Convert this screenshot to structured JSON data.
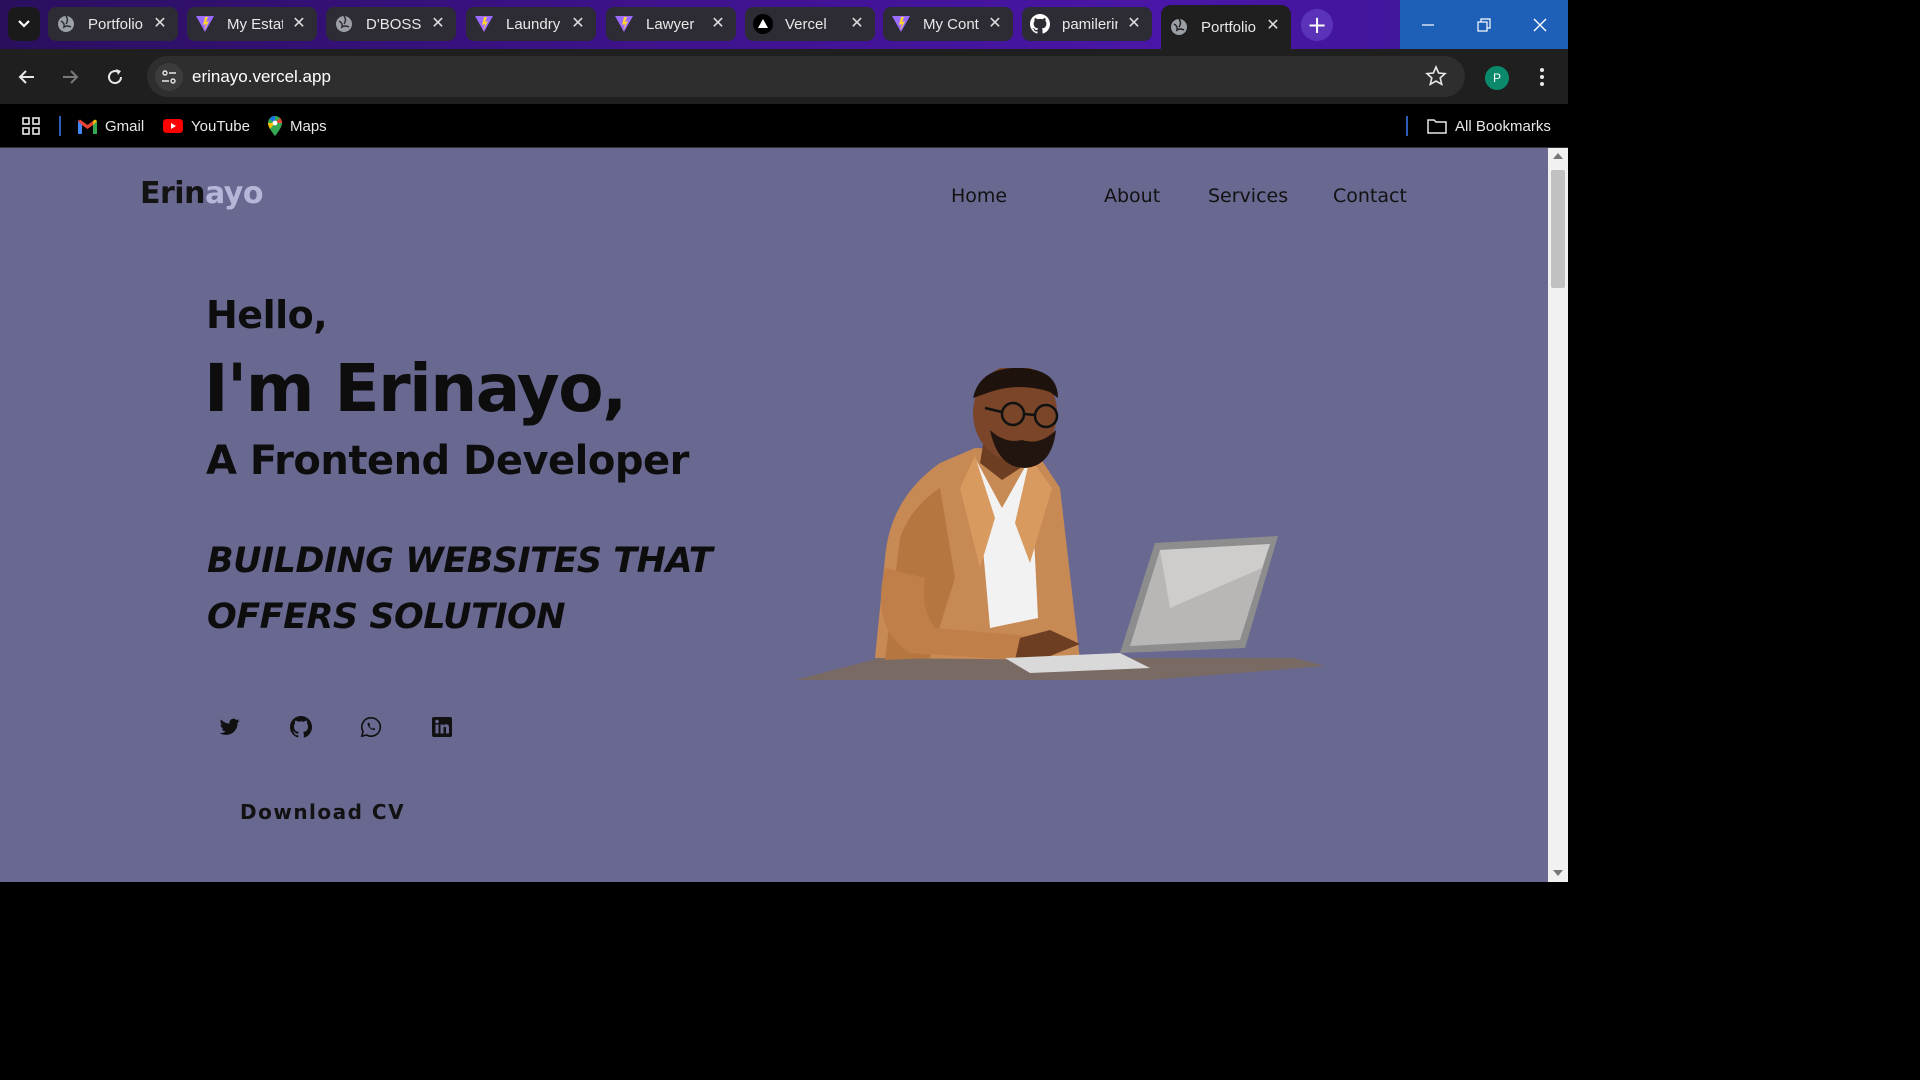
{
  "browser": {
    "tabs": [
      {
        "label": "Portfolio",
        "icon": "globe-icon"
      },
      {
        "label": "My Estate",
        "icon": "vite-icon"
      },
      {
        "label": "D'BOSS",
        "icon": "globe-icon"
      },
      {
        "label": "Laundry",
        "icon": "vite-icon"
      },
      {
        "label": "Lawyer",
        "icon": "vite-icon"
      },
      {
        "label": "Vercel",
        "icon": "vercel-icon"
      },
      {
        "label": "My Contacts",
        "icon": "vite-icon"
      },
      {
        "label": "pamilerin",
        "icon": "github-icon"
      },
      {
        "label": "Portfolio",
        "icon": "globe-icon",
        "active": true
      }
    ],
    "url": "erinayo.vercel.app",
    "profile_initial": "P",
    "bookmarks": [
      {
        "label": "Gmail",
        "icon": "gmail-icon"
      },
      {
        "label": "YouTube",
        "icon": "youtube-icon"
      },
      {
        "label": "Maps",
        "icon": "maps-icon"
      }
    ],
    "all_bookmarks_label": "All Bookmarks"
  },
  "site": {
    "logo": {
      "part1": "Erin",
      "part2": "ayo"
    },
    "nav": [
      "Home",
      "About",
      "Services",
      "Contact"
    ],
    "hero": {
      "hello": "Hello,",
      "name": "I'm Erinayo,",
      "role": "A Frontend Developer",
      "tagline_line1": "BUILDING WEBSITES THAT",
      "tagline_line2": "OFFERS SOLUTION"
    },
    "social": [
      "twitter-icon",
      "github-icon",
      "whatsapp-icon",
      "linkedin-icon"
    ],
    "cta": "Download CV"
  },
  "colors": {
    "page_bg": "#686891",
    "logo_accent": "#b8b6d8",
    "text": "#0d0d0d"
  }
}
